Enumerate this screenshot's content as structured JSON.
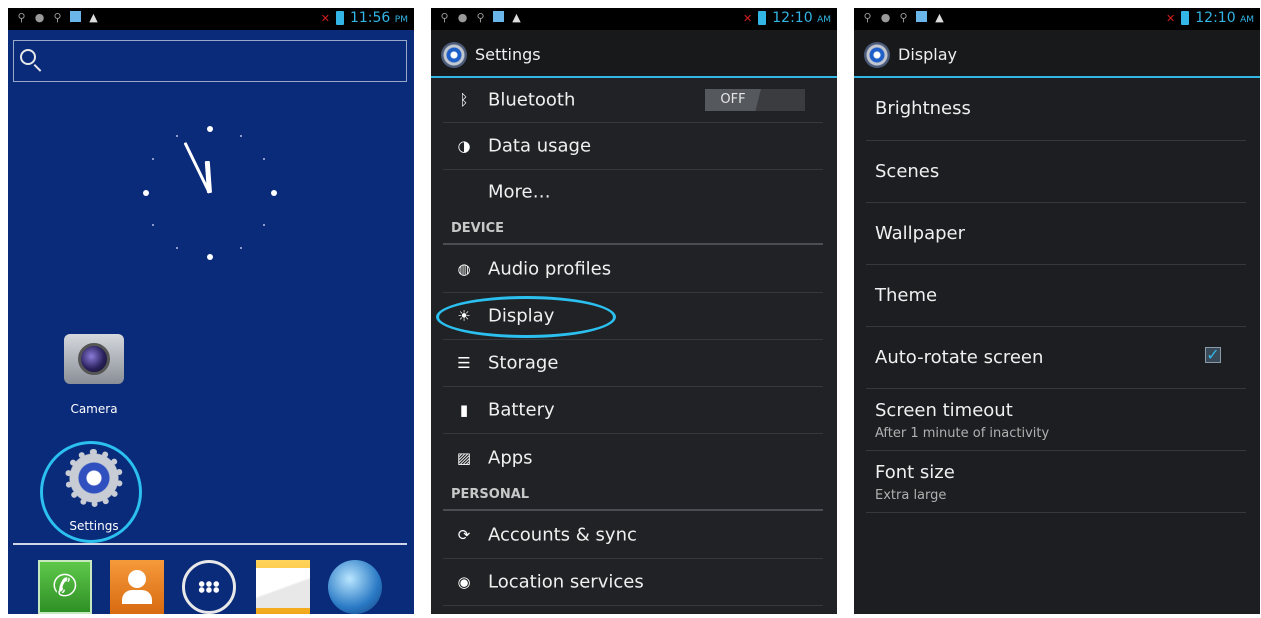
{
  "home": {
    "time": "11:56",
    "ampm": "PM",
    "apps": [
      {
        "label": "Camera"
      },
      {
        "label": "Settings"
      }
    ]
  },
  "settings": {
    "time": "12:10",
    "ampm": "AM",
    "title": "Settings",
    "items": {
      "bluetooth": "Bluetooth",
      "bluetooth_toggle": "OFF",
      "data_usage": "Data usage",
      "more": "More…",
      "section_device": "DEVICE",
      "audio_profiles": "Audio profiles",
      "display": "Display",
      "storage": "Storage",
      "battery": "Battery",
      "apps": "Apps",
      "section_personal": "PERSONAL",
      "accounts_sync": "Accounts & sync",
      "location_services": "Location services"
    }
  },
  "display": {
    "time": "12:10",
    "ampm": "AM",
    "title": "Display",
    "items": {
      "brightness": "Brightness",
      "scenes": "Scenes",
      "wallpaper": "Wallpaper",
      "theme": "Theme",
      "auto_rotate": "Auto-rotate screen",
      "auto_rotate_checked": true,
      "screen_timeout": "Screen timeout",
      "screen_timeout_value": "After 1 minute of inactivity",
      "font_size": "Font size",
      "font_size_value": "Extra large"
    }
  }
}
